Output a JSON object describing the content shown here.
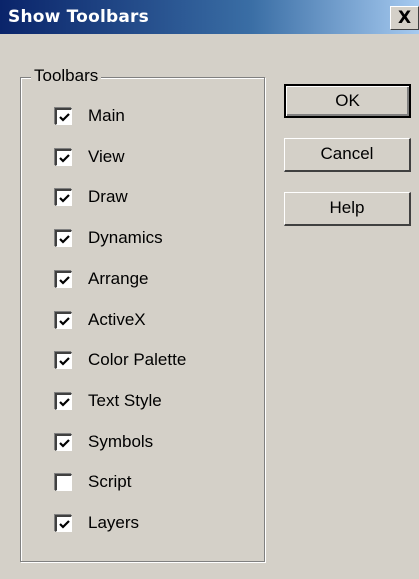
{
  "window": {
    "title": "Show Toolbars",
    "close_label": "X"
  },
  "toolbars_group": {
    "legend": "Toolbars",
    "items": [
      {
        "label": "Main",
        "checked": true
      },
      {
        "label": "View",
        "checked": true
      },
      {
        "label": "Draw",
        "checked": true
      },
      {
        "label": "Dynamics",
        "checked": true
      },
      {
        "label": "Arrange",
        "checked": true
      },
      {
        "label": "ActiveX",
        "checked": true
      },
      {
        "label": "Color Palette",
        "checked": true
      },
      {
        "label": "Text Style",
        "checked": true
      },
      {
        "label": "Symbols",
        "checked": true
      },
      {
        "label": "Script",
        "checked": false
      },
      {
        "label": "Layers",
        "checked": true
      }
    ]
  },
  "buttons": {
    "ok": "OK",
    "cancel": "Cancel",
    "help": "Help"
  },
  "colors": {
    "dialog_bg": "#d4d0c8",
    "title_start": "#0a246a",
    "title_end": "#a6caf0"
  }
}
